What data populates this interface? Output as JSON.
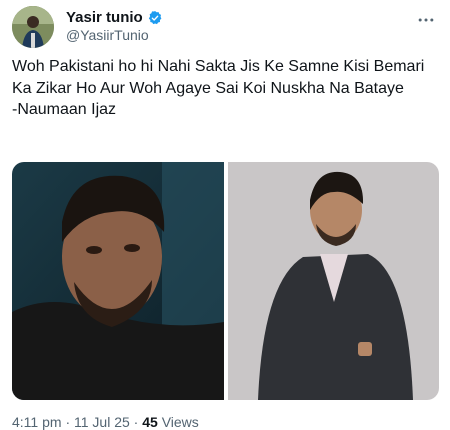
{
  "author": {
    "display_name": "Yasir tunio",
    "handle": "@YasiirTunio",
    "verified": true,
    "verified_color": "#1d9bf0"
  },
  "tweet": {
    "lines": [
      "Woh Pakistani ho hi Nahi Sakta Jis Ke Samne Kisi Bemari Ka Zikar Ho Aur Woh Agaye Sai Koi Nuskha Na Bataye",
      "-Naumaan Ijaz"
    ]
  },
  "media": {
    "count": 2
  },
  "meta": {
    "time": "4:11 pm",
    "separator": "·",
    "date": "11 Jul 25",
    "views_count": "45",
    "views_label": "Views"
  },
  "icons": {
    "more": "more-options-icon",
    "verified": "verified-badge-icon"
  }
}
